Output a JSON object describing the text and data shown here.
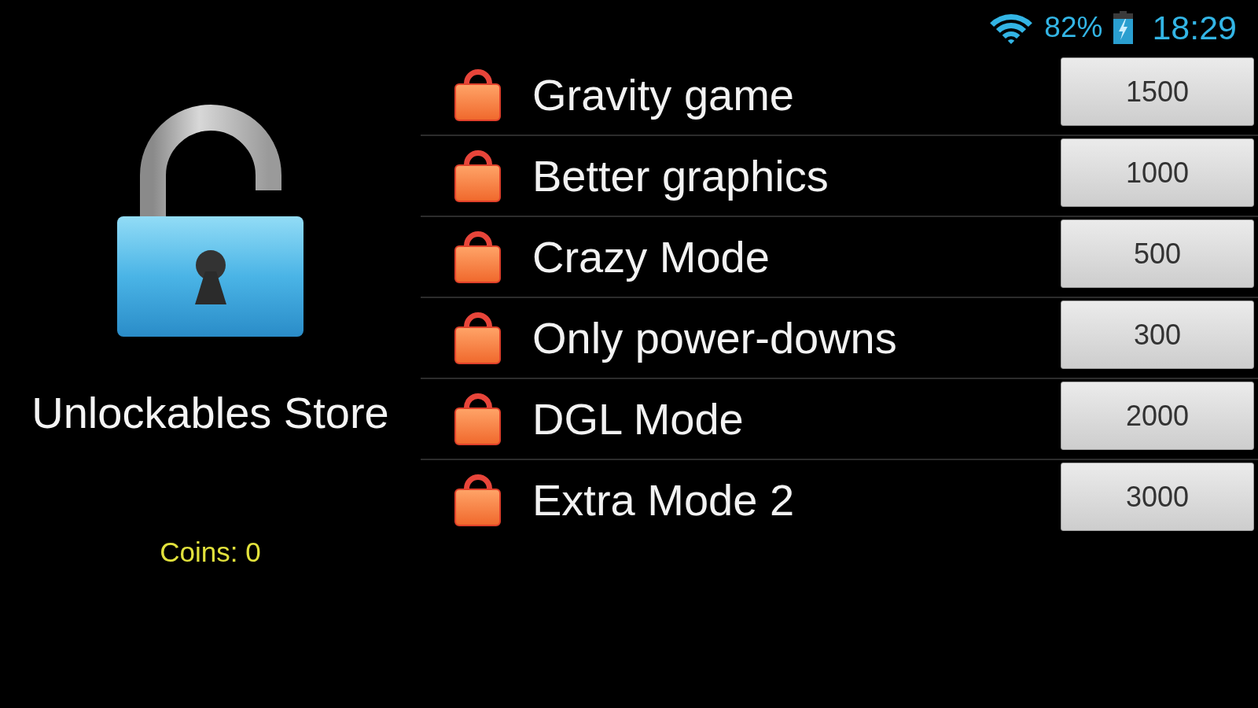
{
  "status_bar": {
    "battery_percent": "82%",
    "charging": true,
    "time": "18:29"
  },
  "store": {
    "title": "Unlockables Store",
    "coins": "Coins: 0"
  },
  "items": [
    {
      "label": "Gravity game",
      "price": "1500",
      "locked": true
    },
    {
      "label": "Better graphics",
      "price": "1000",
      "locked": true
    },
    {
      "label": "Crazy Mode",
      "price": "500",
      "locked": true
    },
    {
      "label": "Only power-downs",
      "price": "300",
      "locked": true
    },
    {
      "label": "DGL Mode",
      "price": "2000",
      "locked": true
    },
    {
      "label": "Extra Mode 2",
      "price": "3000",
      "locked": true
    }
  ]
}
